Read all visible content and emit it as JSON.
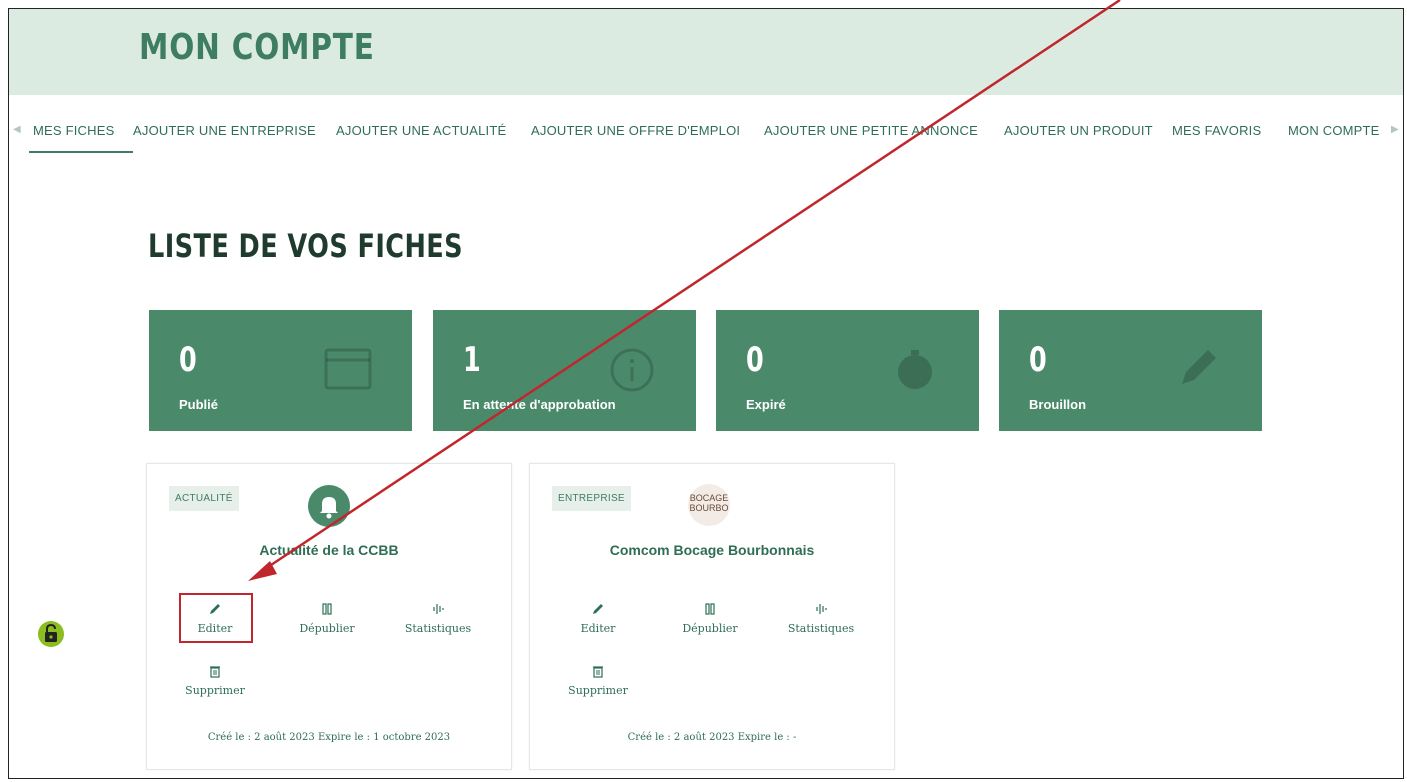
{
  "header": {
    "title": "MON COMPTE"
  },
  "tabs": [
    {
      "label": "MES FICHES"
    },
    {
      "label": "AJOUTER UNE ENTREPRISE"
    },
    {
      "label": "AJOUTER UNE ACTUALITÉ"
    },
    {
      "label": "AJOUTER UNE OFFRE D'EMPLOI"
    },
    {
      "label": "AJOUTER UNE PETITE ANNONCE"
    },
    {
      "label": "AJOUTER UN PRODUIT"
    },
    {
      "label": "MES FAVORIS"
    },
    {
      "label": "MON COMPTE"
    }
  ],
  "section": {
    "title": "LISTE DE VOS FICHES"
  },
  "stats": [
    {
      "value": "0",
      "label": "Publié",
      "icon": "browser-window-icon"
    },
    {
      "value": "1",
      "label": "En attente d'approbation",
      "icon": "info-icon"
    },
    {
      "value": "0",
      "label": "Expiré",
      "icon": "stopwatch-icon"
    },
    {
      "value": "0",
      "label": "Brouillon",
      "icon": "pencil-icon"
    }
  ],
  "cards": [
    {
      "badge": "ACTUALITÉ",
      "title": "Actualité de la CCBB",
      "actions": {
        "edit": "Editer",
        "unpublish": "Dépublier",
        "stats": "Statistiques",
        "delete": "Supprimer"
      },
      "meta": "Créé le :  2 août 2023   Expire le :  1 octobre 2023"
    },
    {
      "badge": "ENTREPRISE",
      "title": "Comcom Bocage Bourbonnais",
      "logo_text": "BOCAGE BOURBO",
      "actions": {
        "edit": "Editer",
        "unpublish": "Dépublier",
        "stats": "Statistiques",
        "delete": "Supprimer"
      },
      "meta": "Créé le :  2 août 2023   Expire le :  -"
    }
  ],
  "colors": {
    "accent": "#4a8a6b",
    "header_bg": "#dcebe1",
    "annotation": "#c0272d"
  }
}
